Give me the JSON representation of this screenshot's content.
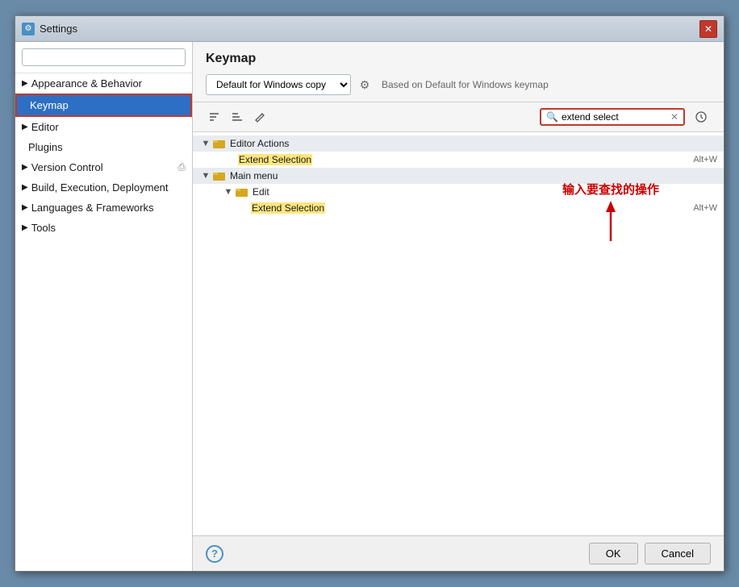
{
  "window": {
    "title": "Settings",
    "icon": "⚙"
  },
  "sidebar": {
    "search_placeholder": "",
    "items": [
      {
        "id": "appearance",
        "label": "Appearance & Behavior",
        "type": "group",
        "expanded": false
      },
      {
        "id": "keymap",
        "label": "Keymap",
        "type": "item",
        "selected": true
      },
      {
        "id": "editor",
        "label": "Editor",
        "type": "group",
        "expanded": false
      },
      {
        "id": "plugins",
        "label": "Plugins",
        "type": "item"
      },
      {
        "id": "version-control",
        "label": "Version Control",
        "type": "group",
        "expanded": false
      },
      {
        "id": "build",
        "label": "Build, Execution, Deployment",
        "type": "group",
        "expanded": false
      },
      {
        "id": "languages",
        "label": "Languages & Frameworks",
        "type": "group",
        "expanded": false
      },
      {
        "id": "tools",
        "label": "Tools",
        "type": "group",
        "expanded": false
      }
    ]
  },
  "main": {
    "title": "Keymap",
    "keymap_select": "Default for Windows copy",
    "keymap_based": "Based on Default for Windows keymap",
    "search_value": "extend select",
    "search_placeholder": "extend select",
    "tree": {
      "groups": [
        {
          "id": "editor-actions",
          "label": "Editor Actions",
          "expanded": true,
          "items": [
            {
              "label": "Extend Selection",
              "shortcut": "Alt+W",
              "highlighted": true
            }
          ]
        },
        {
          "id": "main-menu",
          "label": "Main menu",
          "expanded": true,
          "sub_groups": [
            {
              "id": "edit",
              "label": "Edit",
              "expanded": true,
              "items": [
                {
                  "label": "Extend Selection",
                  "shortcut": "Alt+W",
                  "highlighted": true
                }
              ]
            }
          ]
        }
      ]
    }
  },
  "annotation": {
    "text": "输入要查找的操作",
    "arrow": "↑"
  },
  "buttons": {
    "ok": "OK",
    "cancel": "Cancel"
  }
}
